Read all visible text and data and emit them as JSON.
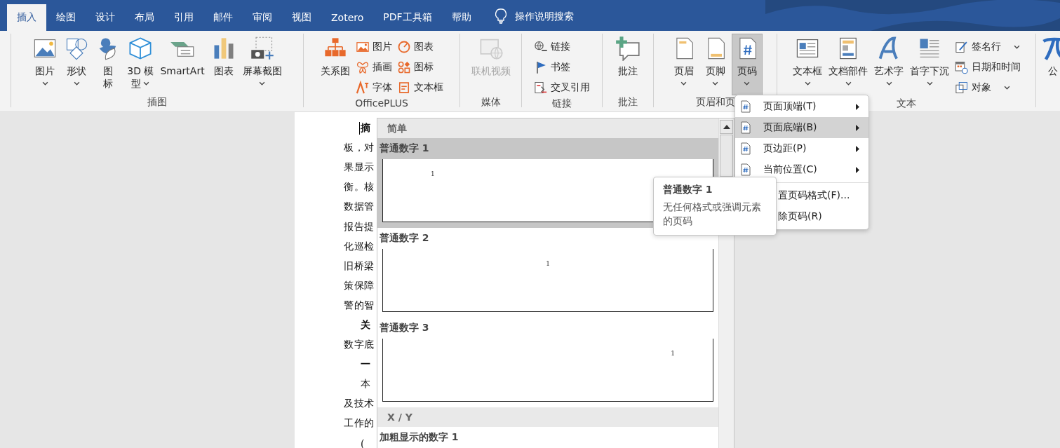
{
  "tabs": [
    {
      "label": "插入",
      "selected": true
    },
    {
      "label": "绘图",
      "selected": false
    },
    {
      "label": "设计",
      "selected": false
    },
    {
      "label": "布局",
      "selected": false
    },
    {
      "label": "引用",
      "selected": false
    },
    {
      "label": "邮件",
      "selected": false
    },
    {
      "label": "审阅",
      "selected": false
    },
    {
      "label": "视图",
      "selected": false
    },
    {
      "label": "Zotero",
      "selected": false
    },
    {
      "label": "PDF工具箱",
      "selected": false
    },
    {
      "label": "帮助",
      "selected": false
    }
  ],
  "search": {
    "label": "操作说明搜索"
  },
  "ribbon": {
    "groups": [
      {
        "label": "插图",
        "items": [
          {
            "kind": "large",
            "lines": [
              "图片"
            ],
            "dropdown": true
          },
          {
            "kind": "large",
            "lines": [
              "形状"
            ],
            "dropdown": true
          },
          {
            "kind": "large",
            "lines": [
              "图",
              "标"
            ],
            "dropdown": false
          },
          {
            "kind": "large",
            "lines": [
              "3D 模",
              "型"
            ],
            "dropdown": true
          },
          {
            "kind": "large",
            "lines": [
              "SmartArt"
            ],
            "dropdown": false
          },
          {
            "kind": "large",
            "lines": [
              "图表"
            ],
            "dropdown": false
          },
          {
            "kind": "large",
            "lines": [
              "屏幕截图"
            ],
            "dropdown": true
          }
        ]
      },
      {
        "label": "OfficePLUS",
        "items": [
          {
            "kind": "large",
            "lines": [
              "关系图"
            ],
            "dropdown": false
          },
          {
            "kind": "stack",
            "items": [
              {
                "label": "图片",
                "dropdown": false
              },
              {
                "label": "插画",
                "dropdown": false
              },
              {
                "label": "字体",
                "dropdown": false
              }
            ]
          },
          {
            "kind": "stack",
            "items": [
              {
                "label": "图表",
                "dropdown": false
              },
              {
                "label": "图标",
                "dropdown": false
              },
              {
                "label": "文本框",
                "dropdown": false
              }
            ]
          }
        ]
      },
      {
        "label": "媒体",
        "items": [
          {
            "kind": "large",
            "lines": [
              "联机视频"
            ],
            "dropdown": false,
            "disabled": true
          }
        ]
      },
      {
        "label": "链接",
        "items": [
          {
            "kind": "stack",
            "items": [
              {
                "label": "链接",
                "dropdown": false
              },
              {
                "label": "书签",
                "dropdown": false
              },
              {
                "label": "交叉引用",
                "dropdown": false
              }
            ]
          }
        ]
      },
      {
        "label": "批注",
        "items": [
          {
            "kind": "large",
            "lines": [
              "批注"
            ],
            "dropdown": false
          }
        ]
      },
      {
        "label": "页眉和页",
        "items": [
          {
            "kind": "large",
            "lines": [
              "页眉"
            ],
            "dropdown": true
          },
          {
            "kind": "large",
            "lines": [
              "页脚"
            ],
            "dropdown": true
          },
          {
            "kind": "large",
            "lines": [
              "页码"
            ],
            "dropdown": true,
            "selected": true
          }
        ]
      },
      {
        "label": "文本",
        "items": [
          {
            "kind": "large",
            "lines": [
              "文本框"
            ],
            "dropdown": true
          },
          {
            "kind": "large",
            "lines": [
              "文档部件"
            ],
            "dropdown": true
          },
          {
            "kind": "large",
            "lines": [
              "艺术字"
            ],
            "dropdown": true
          },
          {
            "kind": "large",
            "lines": [
              "首字下沉"
            ],
            "dropdown": true
          },
          {
            "kind": "stack",
            "items": [
              {
                "label": "签名行",
                "dropdown": true
              },
              {
                "label": "日期和时间",
                "dropdown": false
              },
              {
                "label": "对象",
                "dropdown": true
              }
            ]
          }
        ]
      },
      {
        "items": [
          {
            "kind": "large",
            "lines": [
              "公"
            ],
            "dropdown": false
          }
        ]
      }
    ]
  },
  "document": {
    "lines": [
      {
        "kind": "heading",
        "text": "摘"
      },
      {
        "kind": "body",
        "text": "板，对"
      },
      {
        "kind": "body",
        "text": "果显示"
      },
      {
        "kind": "body",
        "text": "衡。核"
      },
      {
        "kind": "body",
        "text": "数据管"
      },
      {
        "kind": "body",
        "text": "报告提"
      },
      {
        "kind": "body",
        "text": "化巡检"
      },
      {
        "kind": "body",
        "text": "旧桥梁"
      },
      {
        "kind": "body",
        "text": "策保障"
      },
      {
        "kind": "body",
        "text": "警的智"
      },
      {
        "kind": "heading",
        "text": "关"
      },
      {
        "kind": "body",
        "text": "数字底"
      },
      {
        "kind": "heading",
        "text": "一"
      },
      {
        "kind": "indent",
        "text": "本"
      },
      {
        "kind": "body",
        "text": "及技术"
      },
      {
        "kind": "body",
        "text": "工作的"
      },
      {
        "kind": "indent",
        "text": "("
      }
    ]
  },
  "gallery": {
    "sections": [
      {
        "kind": "header",
        "label": "简单"
      },
      {
        "kind": "item",
        "label": "普通数字 1",
        "selected": true,
        "preview": {
          "kind": "left",
          "number": "1"
        }
      },
      {
        "kind": "item",
        "label": "普通数字 2",
        "selected": false,
        "preview": {
          "kind": "center",
          "number": "1"
        }
      },
      {
        "kind": "item",
        "label": "普通数字 3",
        "selected": false,
        "preview": {
          "kind": "right",
          "number": "1"
        }
      },
      {
        "kind": "header",
        "label": "X / Y"
      },
      {
        "kind": "item",
        "label": "加粗显示的数字 1",
        "selected": false
      }
    ]
  },
  "menu": {
    "items": [
      {
        "kind": "item",
        "label": "页面顶端(T)",
        "submenu": true,
        "selected": false
      },
      {
        "kind": "item",
        "label": "页面底端(B)",
        "submenu": true,
        "selected": true
      },
      {
        "kind": "item",
        "label": "页边距(P)",
        "submenu": true,
        "selected": false
      },
      {
        "kind": "item",
        "label": "当前位置(C)",
        "submenu": true,
        "selected": false
      },
      {
        "kind": "separator"
      },
      {
        "kind": "partial",
        "label": "置页码格式(F)...",
        "submenu": false,
        "selected": false
      },
      {
        "kind": "partial",
        "label": "除页码(R)",
        "submenu": false,
        "selected": false
      }
    ]
  },
  "tooltip": {
    "title": "普通数字 1",
    "text": "无任何格式或强调元素的页码"
  }
}
